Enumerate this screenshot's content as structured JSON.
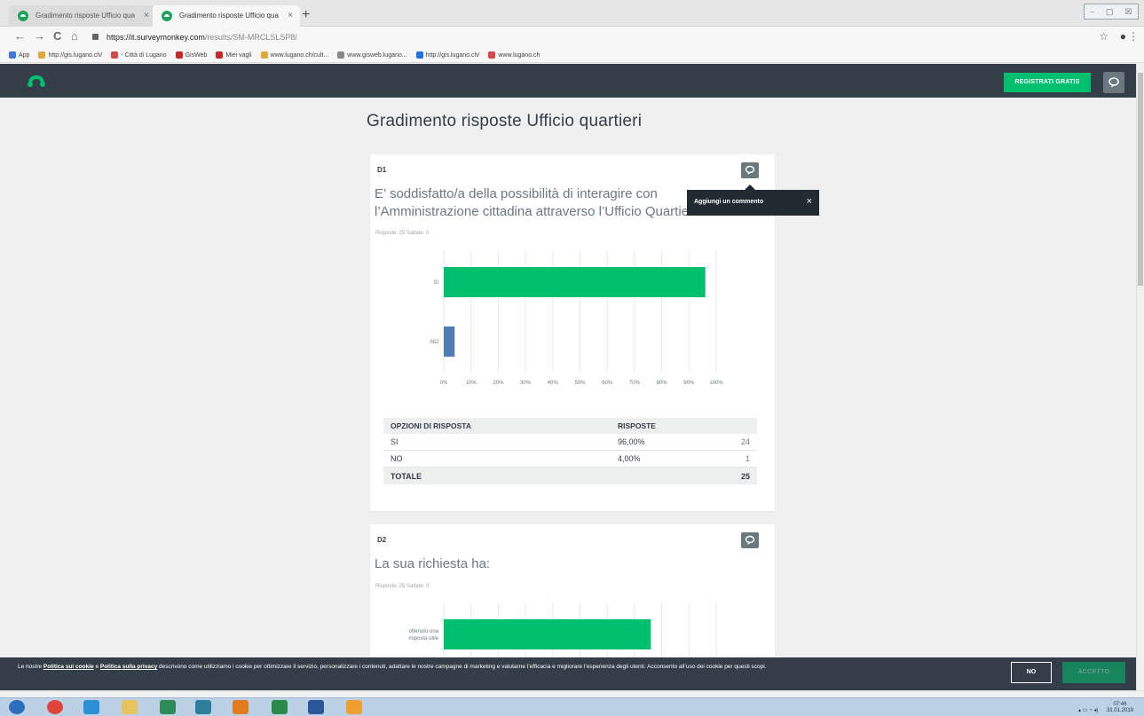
{
  "browser": {
    "tabs": [
      {
        "label": "Gradimento risposte Ufficio qua",
        "close": "×",
        "active": false
      },
      {
        "label": "Gradimento risposte Ufficio qua",
        "close": "×",
        "active": true
      }
    ],
    "new_tab": "+",
    "window_controls": [
      "⎯",
      "▢",
      "☒"
    ],
    "nav": {
      "back": "←",
      "forward": "→",
      "reload": "C",
      "home": "⌂"
    },
    "url_host": "https://it.surveymonkey.com",
    "url_path": "/results/SM-MRCLSLSP8/",
    "star": "☆",
    "profile": "●",
    "menu": "⋮",
    "bookmarks": [
      {
        "label": "App",
        "icon": "apps-icon",
        "color": "#3d7bd6"
      },
      {
        "label": "http://gis.lugano.ch/",
        "icon": "lugano-icon",
        "color": "#e0a83a"
      },
      {
        "label": "- Città di Lugano",
        "icon": "city-icon",
        "color": "#d84a4a"
      },
      {
        "label": "GisWeb",
        "icon": "gisweb-icon",
        "color": "#c62828"
      },
      {
        "label": "Miei vagli",
        "icon": "folder-icon",
        "color": "#c62828"
      },
      {
        "label": "www.lugano.ch/cult...",
        "icon": "lugano-icon",
        "color": "#e0a83a"
      },
      {
        "label": "www.gisweb.lugano...",
        "icon": "page-icon",
        "color": "#888888"
      },
      {
        "label": "http://gis.lugano.ch/",
        "icon": "download-icon",
        "color": "#1a73e8"
      },
      {
        "label": "www.lugano.ch",
        "icon": "city-icon",
        "color": "#d84a4a"
      }
    ]
  },
  "header": {
    "register_label": "REGISTRATI GRATIS"
  },
  "page_title": "Gradimento risposte Ufficio quartieri",
  "q1": {
    "number": "D1",
    "title": "E’ soddisfatto/a della possibilità di interagire con l’Amministrazione cittadina attraverso l’Ufficio Quartieri?",
    "stats": "Risposte: 25    Saltate: 0",
    "chart_data": {
      "type": "bar",
      "orientation": "horizontal",
      "categories": [
        "SI",
        "NO"
      ],
      "values": [
        96,
        4
      ],
      "unit": "%",
      "xlim": [
        0,
        100
      ],
      "xticks": [
        "0%",
        "10%",
        "20%",
        "30%",
        "40%",
        "50%",
        "60%",
        "70%",
        "80%",
        "90%",
        "100%"
      ],
      "colors": [
        "#00bf6f",
        "#507cb6"
      ],
      "grid": true
    },
    "table": {
      "headers": [
        "OPZIONI DI RISPOSTA",
        "RISPOSTE",
        ""
      ],
      "rows": [
        {
          "option": "SI",
          "percent": "96,00%",
          "count": "24"
        },
        {
          "option": "NO",
          "percent": "4,00%",
          "count": "1"
        }
      ],
      "total_label": "TOTALE",
      "total_count": "25"
    }
  },
  "tooltip": {
    "text": "Aggiungi un commento",
    "close": "×"
  },
  "q2": {
    "number": "D2",
    "title": "La sua richiesta ha:",
    "stats": "Risposte: 25    Saltate: 0",
    "chart_data": {
      "type": "bar",
      "orientation": "horizontal",
      "categories": [
        "ottenuto una risposta utile"
      ],
      "category_lines": [
        [
          "ottenuto una",
          "risposta utile"
        ]
      ],
      "values": [
        76
      ],
      "unit": "%",
      "xlim": [
        0,
        100
      ],
      "colors": [
        "#00bf6f"
      ],
      "grid": true
    }
  },
  "cookie": {
    "text_before": "Le nostre ",
    "link1": "Politica sui cookie",
    "text_mid": " e ",
    "link2": "Politica sulla privacy",
    "text_after": " descrivono come utilizziamo i cookie per ottimizzare il servizio, personalizzare i contenuti, adattare le nostre campagne di marketing e valutarne l’efficacia e migliorare l’esperienza degli utenti. Acconsento all’uso dei cookie per questi scopi.",
    "no_label": "NO",
    "accept_label": "ACCETTO"
  },
  "taskbar": {
    "apps": [
      {
        "icon": "windows-start-icon",
        "color": "#2a6ebd"
      },
      {
        "icon": "chrome-icon",
        "color": "#e0453a"
      },
      {
        "icon": "internet-explorer-icon",
        "color": "#2b8fd6"
      },
      {
        "icon": "explorer-folder-icon",
        "color": "#e8c25a"
      },
      {
        "icon": "excel-icon",
        "color": "#2e8b57"
      },
      {
        "icon": "publisher-icon",
        "color": "#2e7d9a"
      },
      {
        "icon": "media-player-icon",
        "color": "#e07b1f"
      },
      {
        "icon": "project-icon",
        "color": "#2a8a4a"
      },
      {
        "icon": "word-icon",
        "color": "#2b579a"
      },
      {
        "icon": "app-icon",
        "color": "#f0a030"
      }
    ],
    "time": "07:46",
    "date": "31.01.2019",
    "tray_icons": "▴ ▭ ◔ ◂)"
  }
}
